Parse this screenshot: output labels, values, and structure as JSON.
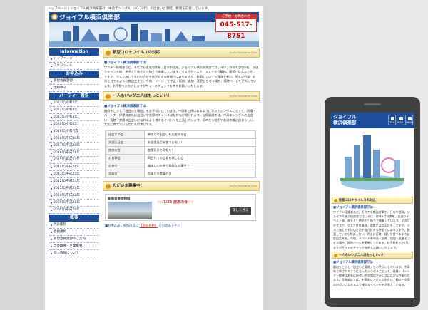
{
  "topline": "トップページ | ジョイフル横浜俱楽部は、中高年シングル（40-70代）の出会いと親睦、懇親を応援しています。",
  "site": {
    "logo": "ジョイフル横浜倶楽部",
    "tel_label": "ご予約 / お問合わせ",
    "tel": "045-517-8751"
  },
  "sidebar": {
    "sections": [
      {
        "title": "Information",
        "items": [
          "トップページ",
          "スケジュール"
        ]
      },
      {
        "title": "お申込み",
        "items": [
          "新付会員登録",
          "予約申込"
        ]
      },
      {
        "title": "パーティー報告",
        "items": [
          "2023年/令和5年",
          "2022年/令和4年",
          "2021年/令和3年",
          "2020年/令和2年",
          "2019年/令和元年",
          "2018年/平成30年",
          "2017年/平成29年",
          "2016年/平成28年",
          "2015年/平成27年",
          "2014年/平成26年",
          "2013年/平成25年",
          "2012年/平成24年",
          "2011年/平成23年",
          "2010年/平成22年",
          "2009年/平成21年",
          "2008年/平成20年"
        ]
      },
      {
        "title": "概要",
        "items": [
          "代表挨拶",
          "会員規約",
          "新付会員登録のご案内",
          "当会概要・企業概要",
          "個人情報について"
        ]
      }
    ]
  },
  "main": {
    "covid": {
      "title": "新型コロナウイルスの対応",
      "club": "Joyful Yokohama Club",
      "subhead": "■ジョイフル横浜倶楽部では",
      "body": "ワクチン接種者など、それでも感染対策を、日本中活発。ジョイフル横浜倶楽部ではいえば、昨年3月付体業、お送りイベント後、赤そと？結そと？結そで開業しています。マスクやマスク、マスク会会業務。通常とはなんだそ…ですが、マスク無しでもいいさがや皆が好きな時間ではありますが、飲酒していても飛沫上茶い。明るい日常、自分を持てるように良自工夫を。今後、イベントを中止・延期、追加・変更とさせる場合、随時ページを更新しています。お手数をおかけしますがサイトのチェックを時々お願いいたします。"
    },
    "welcome": {
      "title": "一人もいいが二人はもっといい！",
      "club": "Joyful Yokohama Club",
      "subhead": "■ジョイフル横浜倶楽部では",
      "body": "趣向をこらし「出会いと親睦」をお手伝いしています。中高年と呼ばれるようになったシングルにとって、再婚・パートナー探望はあれば出会いや交際のチャンスはなかなか限られます。当倶楽部では、中高年シングルの出会い・親睦・交際の出会いになれるよう様々なイベントを企画しています。気の合う相手や友達の輪に自分らしい、大切に育てていただければ幸いです。",
      "table": [
        [
          "出会いの会",
          "異性との出会いを応援する会"
        ],
        [
          "お誕生日会",
          "お誕生日月を皆でお祝い！"
        ],
        [
          "旅旅の会",
          "散策気分で気軽を！"
        ],
        [
          "お食事会",
          "同世代での会食を楽しむ会"
        ],
        [
          "お茶会",
          "美味しいお茶と素敵なお菓子で"
        ],
        [
          "音楽会",
          "音楽とお食事の会"
        ]
      ]
    },
    "recruit": {
      "title": "ただいま募集中！",
      "club": "Joyful Yokohama Club",
      "event_tag": "新宿音楽博物館",
      "event_title": "☆☆7/23 旅旅の会☆☆",
      "button": "詳しく見る",
      "link_prefix": "■お申込みご参加の前に",
      "link_text": "【参加規約】",
      "link_suffix": "をお読み下さい"
    }
  },
  "mobile": {
    "logo_line1": "ジョイフル",
    "logo_line2": "横浜倶楽部",
    "icons": [
      "TEL",
      "MAIL",
      "MENU"
    ],
    "covid_title": "新型コロナウイルスの対応",
    "covid_subhead": "■ジョイフル横浜倶楽部では",
    "covid_body": "ワクチン接種者など、それでも感染対策を、日本中活発。ジョイフル横浜倶楽部ではいえば、昨年3月付体業、お送りイベント後、赤そと？結そと？結そで開業しています。マスクやマスク、マスク会会業務。通常とはなんだそ…ですが、マスク無しでもいいさがや皆が好きな時間ではありますが、飲酒していても飛沫上茶い。明るい日常、自分を持てるように良自工夫を。今後、イベントを中止・延期、追加・変更とさせる場合、随時ページを更新しています。お手数をおかけしますがサイトのチェックを時々お願いいたします。",
    "welcome_title": "一人もいいが二人はもっといい！",
    "welcome_subhead": "■ジョイフル横浜倶楽部では",
    "welcome_body": "趣向をこらし「出会いと親睦」をお手伝いしています。中高年と呼ばれるようになったシングルにとって、再婚・パートナー探望はあれば出会いや交際のチャンスはなかなか限られます。当倶楽部では、中高年シングルの出会い・親睦・交際の出会いになれるよう様々なイベントを企画しています。"
  }
}
